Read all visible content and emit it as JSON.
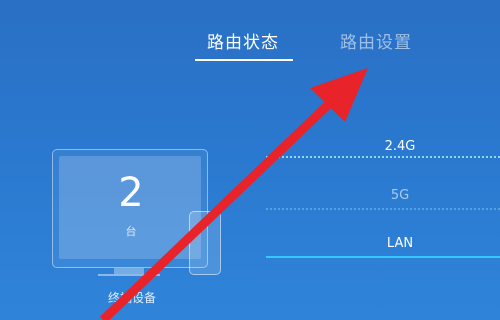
{
  "tabs": {
    "status_label": "路由状态",
    "settings_label": "路由设置"
  },
  "device": {
    "count": "2",
    "unit": "台",
    "label": "终端设备"
  },
  "bands": {
    "band_24g": "2.4G",
    "band_5g": "5G",
    "lan": "LAN"
  },
  "colors": {
    "background": "#2a78cf",
    "active_tab": "#ffffff",
    "lan_line": "#35c8ff",
    "arrow": "#e8232a"
  },
  "icons": {
    "monitor": "monitor-icon",
    "phone": "phone-icon",
    "annotation": "red-arrow"
  }
}
